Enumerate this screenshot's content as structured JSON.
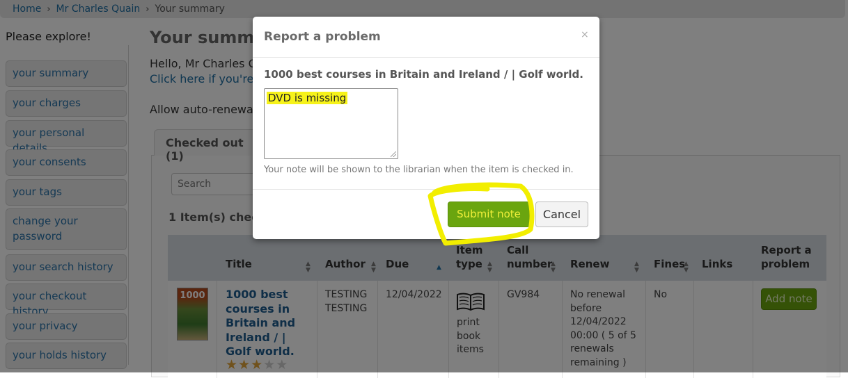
{
  "breadcrumb": {
    "home": "Home",
    "patron": "Mr Charles Quain",
    "current": "Your summary",
    "separator": "›"
  },
  "sidebar": {
    "title": "Please explore!",
    "items": [
      "your summary",
      "your charges",
      "your personal details",
      "your consents",
      "your tags",
      "change your password",
      "your search history",
      "your checkout history",
      "your privacy",
      "your holds history"
    ]
  },
  "main": {
    "title": "Your summa",
    "hello": "Hello, Mr Charles Qu",
    "click_here": "Click here if you're n",
    "auto_renew": "Allow auto-renewal:",
    "tab_checked_out": "Checked out (1)",
    "search_placeholder": "Search",
    "items_count": "1 Item(s) checke"
  },
  "table": {
    "headers": {
      "title": "Title",
      "author": "Author",
      "due": "Due",
      "item_type_1": "Item",
      "item_type_2": "type",
      "call_1": "Call",
      "call_2": "number",
      "renew": "Renew",
      "fines": "Fines",
      "links": "Links",
      "report_1": "Report a",
      "report_2": "problem"
    },
    "row": {
      "cover_text": "1000",
      "title": "1000 best courses in Britain and Ireland / | Golf world.",
      "author_1": "TESTING",
      "author_2": "TESTING",
      "due": "12/04/2022",
      "item_type_1": "print",
      "item_type_2": "book",
      "item_type_3": "items",
      "call_number": "GV984",
      "renew_1": "No renewal",
      "renew_2": "before",
      "renew_3": "12/04/2022",
      "renew_4": "00:00 ( 5 of 5",
      "renew_5": "renewals",
      "renew_6": "remaining )",
      "fines": "No",
      "add_note": "Add note",
      "rating_stars": 3,
      "rating_max": 5
    }
  },
  "modal": {
    "title": "Report a problem",
    "close": "×",
    "book_title": "1000 best courses in Britain and Ireland / | Golf world.",
    "note_value": "DVD is missing",
    "help_text": "Your note will be shown to the librarian when the item is checked in.",
    "submit_label": "Submit note",
    "cancel_label": "Cancel"
  },
  "colors": {
    "accent_green": "#6aa50f",
    "link_blue": "#1e6ea3",
    "highlight_yellow": "#f6f21a"
  }
}
